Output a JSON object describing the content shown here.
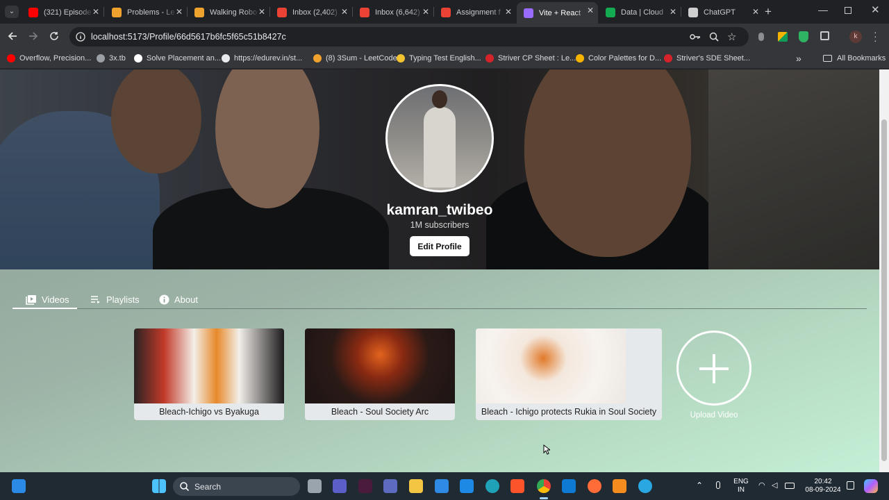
{
  "browser": {
    "tabs": [
      {
        "title": "(321) Episode",
        "favicon": "youtube-icon",
        "color": "#ff0000"
      },
      {
        "title": "Problems - Le",
        "favicon": "leetcode-icon",
        "color": "#f0a22e"
      },
      {
        "title": "Walking Robo",
        "favicon": "leetcode-icon",
        "color": "#f0a22e"
      },
      {
        "title": "Inbox (2,402)",
        "favicon": "gmail-icon",
        "color": "#ea4335"
      },
      {
        "title": "Inbox (6,642)",
        "favicon": "gmail-icon",
        "color": "#ea4335"
      },
      {
        "title": "Assignment f",
        "favicon": "gmail-icon",
        "color": "#ea4335"
      },
      {
        "title": "Vite + React",
        "favicon": "vite-icon",
        "color": "#9a6bff",
        "active": true
      },
      {
        "title": "Data | Cloud",
        "favicon": "mongodb-leaf-icon",
        "color": "#13aa52"
      },
      {
        "title": "ChatGPT",
        "favicon": "chatgpt-icon",
        "color": "#cfcfcf"
      }
    ],
    "url": "localhost:5173/Profile/66d5617b6fc5f65c51b8427c",
    "bookmarks": [
      {
        "label": "Overflow, Precision...",
        "color": "#ff0000"
      },
      {
        "label": "3x.tb",
        "color": "#9aa0a6"
      },
      {
        "label": "Solve Placement an...",
        "color": "#ffffff"
      },
      {
        "label": "https://edurev.in/st...",
        "color": "#e8eaed"
      },
      {
        "label": "(8) 3Sum - LeetCode",
        "color": "#f0a22e"
      },
      {
        "label": "Typing Test English...",
        "color": "#f4c430"
      },
      {
        "label": "Striver CP Sheet : Le...",
        "color": "#d6232a"
      },
      {
        "label": "Color Palettes for D...",
        "color": "#f4b400"
      },
      {
        "label": "Striver's SDE Sheet...",
        "color": "#d6232a"
      }
    ],
    "bookmarks_more": "»",
    "all_bookmarks": "All Bookmarks",
    "profile_initial": "k"
  },
  "profile": {
    "username": "kamran_twibeo",
    "subscribers": "1M subscribers",
    "edit_button": "Edit Profile",
    "tabs": [
      {
        "label": "Videos",
        "icon": "video-library-icon",
        "active": true
      },
      {
        "label": "Playlists",
        "icon": "playlist-icon"
      },
      {
        "label": "About",
        "icon": "info-icon"
      }
    ],
    "videos": [
      {
        "title": "Bleach-Ichigo vs Byakuga"
      },
      {
        "title": "Bleach - Soul Society Arc"
      },
      {
        "title": "Bleach - Ichigo protects Rukia in Soul Society"
      }
    ],
    "upload_label": "Upload Video"
  },
  "taskbar": {
    "search_placeholder": "Search",
    "lang_top": "ENG",
    "lang_bottom": "IN",
    "time": "20:42",
    "date": "08-09-2024"
  }
}
